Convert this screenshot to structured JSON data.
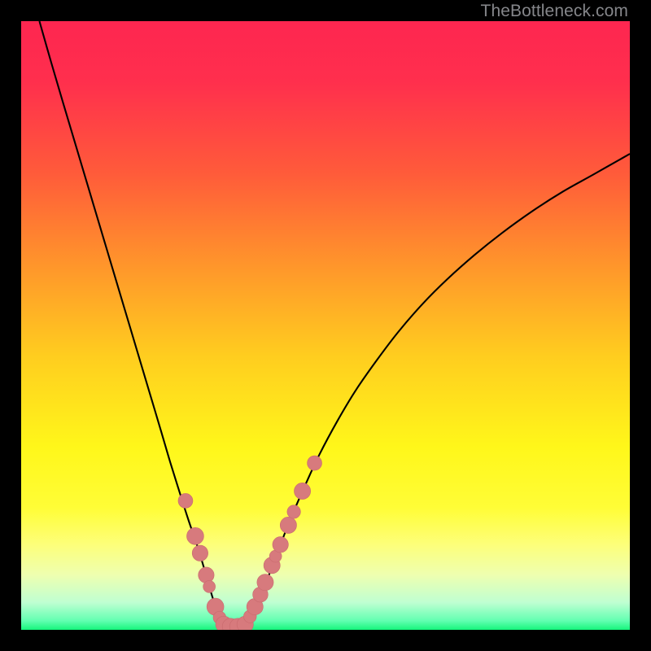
{
  "watermark": "TheBottleneck.com",
  "colors": {
    "gradient_stops": [
      {
        "offset": 0.0,
        "color": "#fe2650"
      },
      {
        "offset": 0.1,
        "color": "#ff2f4d"
      },
      {
        "offset": 0.25,
        "color": "#ff5b3a"
      },
      {
        "offset": 0.4,
        "color": "#ff952b"
      },
      {
        "offset": 0.55,
        "color": "#ffcd1f"
      },
      {
        "offset": 0.7,
        "color": "#fff71a"
      },
      {
        "offset": 0.8,
        "color": "#fffd37"
      },
      {
        "offset": 0.86,
        "color": "#fdff7a"
      },
      {
        "offset": 0.91,
        "color": "#eeffb0"
      },
      {
        "offset": 0.955,
        "color": "#bfffd2"
      },
      {
        "offset": 0.985,
        "color": "#62ffb1"
      },
      {
        "offset": 1.0,
        "color": "#16f57c"
      }
    ],
    "curve": "#000000",
    "marker_fill": "#d77a7d",
    "marker_stroke": "#c96a6e"
  },
  "chart_data": {
    "type": "line",
    "title": "",
    "xlabel": "",
    "ylabel": "",
    "xlim": [
      0,
      100
    ],
    "ylim": [
      0,
      100
    ],
    "series": [
      {
        "name": "left-branch",
        "x": [
          3,
          5,
          7,
          9,
          11,
          13,
          15,
          17,
          19,
          21,
          23,
          24.5,
          26,
          27.5,
          29,
          30,
          31,
          32,
          32.8
        ],
        "y": [
          100,
          93,
          86.2,
          79.5,
          72.8,
          66.1,
          59.4,
          52.7,
          46.0,
          39.3,
          32.6,
          27.5,
          22.7,
          18.0,
          13.6,
          10.3,
          6.8,
          3.5,
          1.0
        ]
      },
      {
        "name": "valley-floor",
        "x": [
          32.8,
          34,
          35.5,
          37
        ],
        "y": [
          1.0,
          0.5,
          0.5,
          1.0
        ]
      },
      {
        "name": "right-branch",
        "x": [
          37,
          38.5,
          40,
          42,
          44,
          46.5,
          49,
          52,
          55,
          58.5,
          62,
          66,
          70,
          74.5,
          79,
          84,
          89,
          94,
          100
        ],
        "y": [
          1.0,
          3.8,
          7.2,
          12.4,
          17.6,
          23.4,
          28.8,
          34.4,
          39.4,
          44.4,
          49.0,
          53.6,
          57.6,
          61.6,
          65.2,
          68.8,
          72.0,
          74.8,
          78.2
        ]
      }
    ],
    "markers": [
      {
        "x": 27.0,
        "y": 21.2,
        "r": 1.2
      },
      {
        "x": 28.6,
        "y": 15.4,
        "r": 1.4
      },
      {
        "x": 29.4,
        "y": 12.6,
        "r": 1.3
      },
      {
        "x": 30.4,
        "y": 9.0,
        "r": 1.3
      },
      {
        "x": 30.9,
        "y": 7.1,
        "r": 1.0
      },
      {
        "x": 31.9,
        "y": 3.8,
        "r": 1.4
      },
      {
        "x": 32.6,
        "y": 2.0,
        "r": 1.05
      },
      {
        "x": 33.3,
        "y": 0.9,
        "r": 1.35
      },
      {
        "x": 34.4,
        "y": 0.55,
        "r": 1.35
      },
      {
        "x": 35.6,
        "y": 0.55,
        "r": 1.35
      },
      {
        "x": 36.8,
        "y": 0.9,
        "r": 1.35
      },
      {
        "x": 37.6,
        "y": 2.2,
        "r": 1.05
      },
      {
        "x": 38.4,
        "y": 3.8,
        "r": 1.35
      },
      {
        "x": 39.3,
        "y": 5.8,
        "r": 1.25
      },
      {
        "x": 40.1,
        "y": 7.8,
        "r": 1.35
      },
      {
        "x": 41.2,
        "y": 10.6,
        "r": 1.35
      },
      {
        "x": 41.8,
        "y": 12.1,
        "r": 1.0
      },
      {
        "x": 42.6,
        "y": 14.0,
        "r": 1.3
      },
      {
        "x": 43.9,
        "y": 17.2,
        "r": 1.35
      },
      {
        "x": 44.8,
        "y": 19.4,
        "r": 1.1
      },
      {
        "x": 46.2,
        "y": 22.8,
        "r": 1.35
      },
      {
        "x": 48.2,
        "y": 27.4,
        "r": 1.2
      }
    ]
  }
}
